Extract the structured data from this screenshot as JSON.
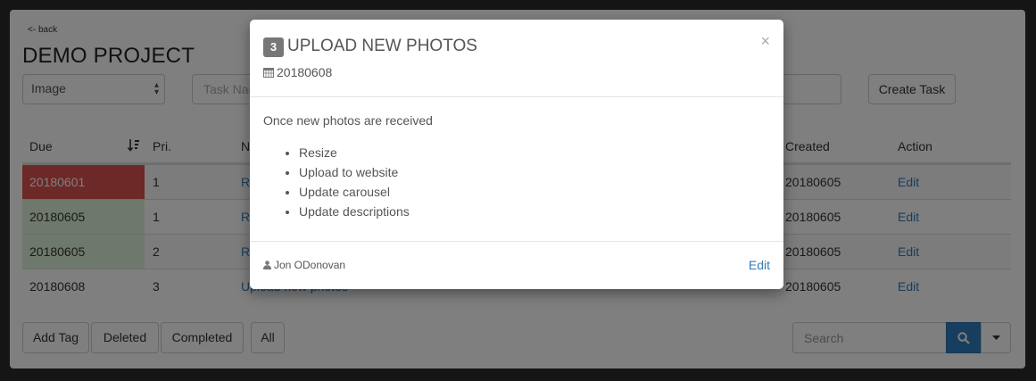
{
  "page": {
    "back_label": "<- back",
    "title": "DEMO PROJECT",
    "type_select_value": "Image",
    "taskname_placeholder": "Task Name",
    "create_task_label": "Create Task"
  },
  "table": {
    "headers": {
      "due": "Due",
      "pri": "Pri.",
      "name": "Name",
      "created": "Created",
      "action": "Action"
    },
    "rows": [
      {
        "due": "20180601",
        "pri": "1",
        "name": "R",
        "created": "20180605",
        "action": "Edit",
        "status": "overdue"
      },
      {
        "due": "20180605",
        "pri": "1",
        "name": "R",
        "created": "20180605",
        "action": "Edit",
        "status": "ok"
      },
      {
        "due": "20180605",
        "pri": "2",
        "name": "R",
        "created": "20180605",
        "action": "Edit",
        "status": "ok"
      },
      {
        "due": "20180608",
        "pri": "3",
        "name": "Upload new photos",
        "created": "20180605",
        "action": "Edit",
        "status": "none"
      }
    ]
  },
  "footer": {
    "add_tag": "Add Tag",
    "deleted": "Deleted",
    "completed": "Completed",
    "all": "All",
    "search_placeholder": "Search"
  },
  "modal": {
    "badge": "3",
    "title": "UPLOAD NEW PHOTOS",
    "date": "20180608",
    "description": "Once new photos are received",
    "items": [
      "Resize",
      "Upload to website",
      "Update carousel",
      "Update descriptions"
    ],
    "author": "Jon ODonovan",
    "edit_label": "Edit",
    "close_label": "×"
  },
  "colors": {
    "overdue": "#d9534f",
    "ok": "#dff0d8",
    "link": "#337ab7",
    "search_button": "#2e7cbd"
  }
}
